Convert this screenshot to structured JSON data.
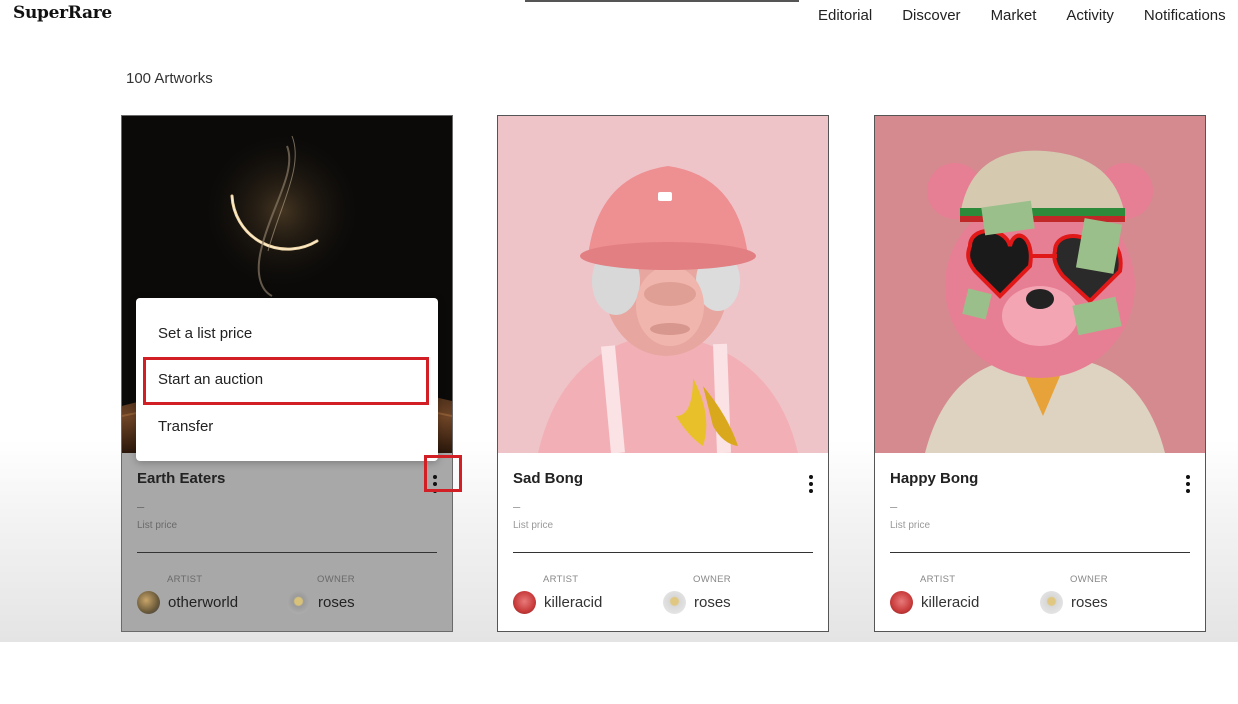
{
  "header": {
    "logo": "SuperRare",
    "nav": [
      "Editorial",
      "Discover",
      "Market",
      "Activity",
      "Notifications"
    ]
  },
  "collection": {
    "count_label": "100 Artworks"
  },
  "cards": [
    {
      "title": "Earth Eaters",
      "price": "–",
      "list_price_label": "List price",
      "artist_label": "ARTIST",
      "artist": "otherworld",
      "owner_label": "OWNER",
      "owner": "roses"
    },
    {
      "title": "Sad Bong",
      "price": "–",
      "list_price_label": "List price",
      "artist_label": "ARTIST",
      "artist": "killeracid",
      "owner_label": "OWNER",
      "owner": "roses"
    },
    {
      "title": "Happy Bong",
      "price": "–",
      "list_price_label": "List price",
      "artist_label": "ARTIST",
      "artist": "killeracid",
      "owner_label": "OWNER",
      "owner": "roses"
    }
  ],
  "context_menu": {
    "items": [
      "Set a list price",
      "Start an auction",
      "Transfer"
    ],
    "highlighted": "Start an auction"
  },
  "colors": {
    "highlight": "#d21f26",
    "art_bg_pink": "#efc4c8",
    "art_bg_rose": "#d48a8f",
    "art_bg_space": "#0b0a09"
  }
}
